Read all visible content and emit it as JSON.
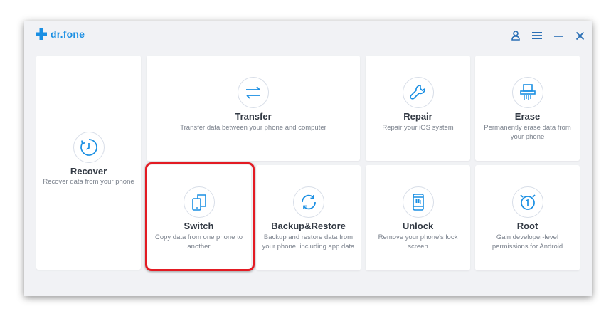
{
  "app": {
    "logo_text": "dr.fone"
  },
  "titlebar": {
    "icons": [
      "user-icon",
      "menu-icon",
      "minimize-icon",
      "close-icon"
    ]
  },
  "cards": {
    "recover": {
      "title": "Recover",
      "desc": "Recover data from your phone",
      "icon": "clock-icon"
    },
    "transfer": {
      "title": "Transfer",
      "desc": "Transfer data between your phone and computer",
      "icon": "transfer-arrows-icon"
    },
    "repair": {
      "title": "Repair",
      "desc": "Repair your iOS system",
      "icon": "wrench-icon"
    },
    "erase": {
      "title": "Erase",
      "desc": "Permanently erase data from your phone",
      "icon": "shredder-icon"
    },
    "switch": {
      "title": "Switch",
      "desc": "Copy data from one phone to another",
      "icon": "phone-switch-icon"
    },
    "backup": {
      "title": "Backup&Restore",
      "desc": "Backup and restore data from your phone, including app data",
      "icon": "sync-icon"
    },
    "unlock": {
      "title": "Unlock",
      "desc": "Remove your phone's lock screen",
      "icon": "phone-lock-icon"
    },
    "root": {
      "title": "Root",
      "desc": "Gain developer-level permissions for Android",
      "icon": "root-icon"
    }
  },
  "colors": {
    "accent": "#1a8fe3",
    "highlight": "#e31b23",
    "window_bg": "#f1f2f5"
  }
}
